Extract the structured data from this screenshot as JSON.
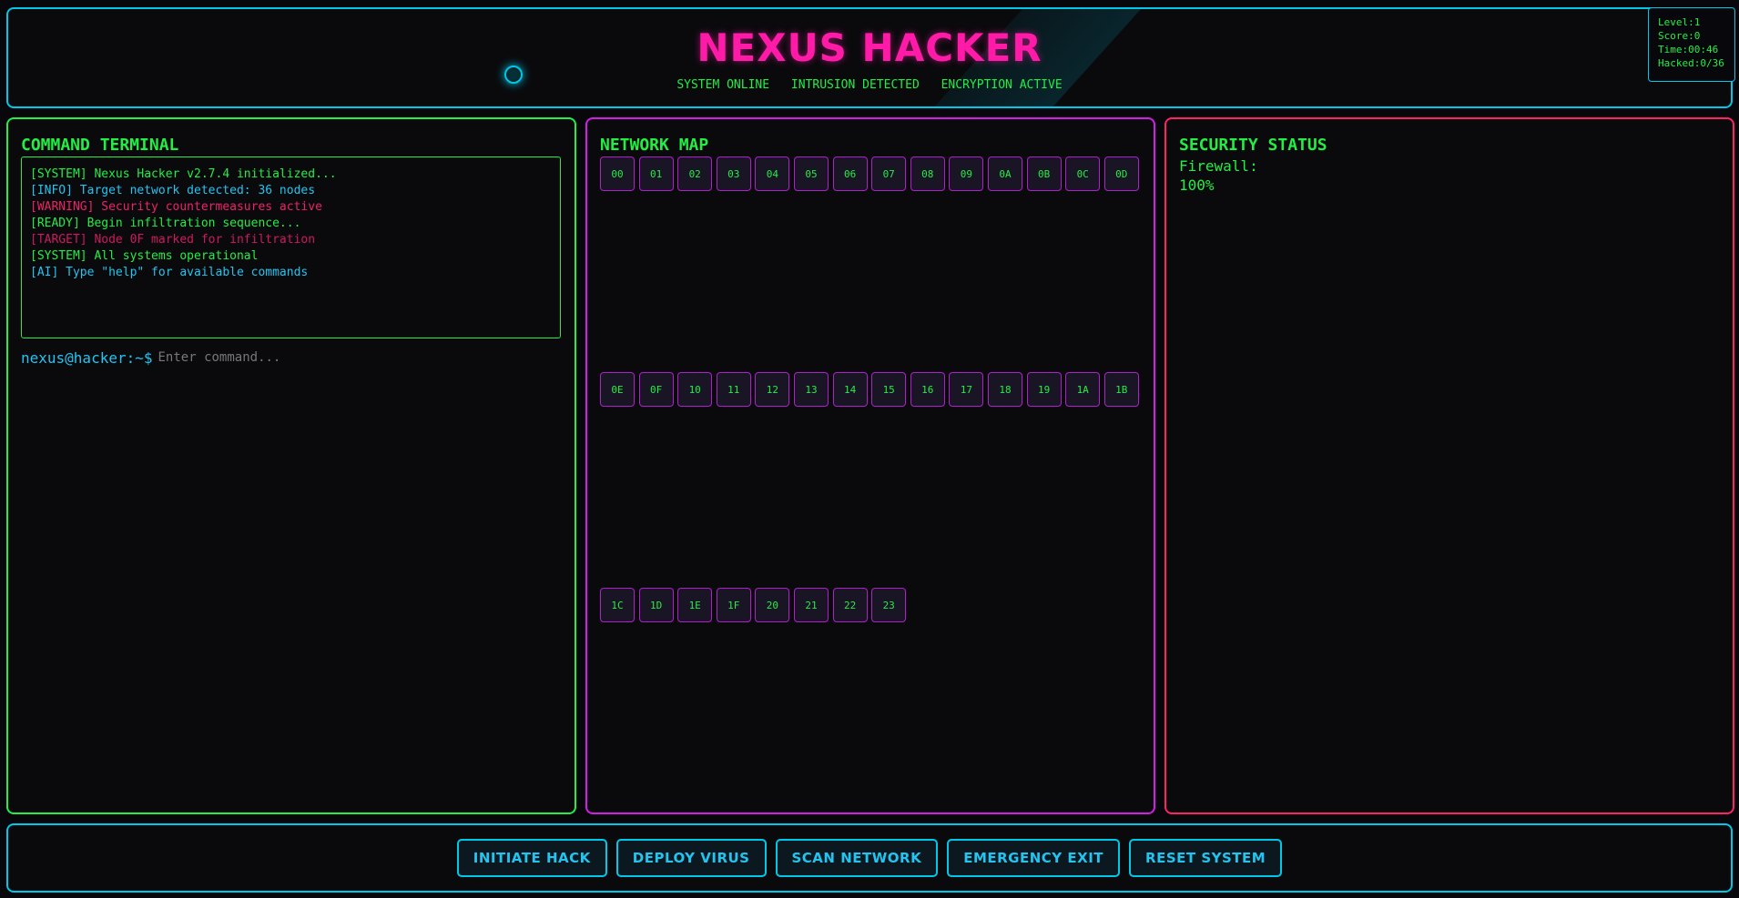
{
  "header": {
    "title": "NEXUS HACKER",
    "status": [
      "SYSTEM ONLINE",
      "INTRUSION DETECTED",
      "ENCRYPTION ACTIVE"
    ]
  },
  "hud": {
    "level": "Level:1",
    "score": "Score:0",
    "time": "Time:00:46",
    "hacked": "Hacked:0/36"
  },
  "terminal": {
    "title": "COMMAND TERMINAL",
    "log": [
      {
        "text": "[SYSTEM] Nexus Hacker v2.7.4 initialized...",
        "color": "#22ee44"
      },
      {
        "text": "[INFO] Target network detected: 36 nodes",
        "color": "#22c4f0"
      },
      {
        "text": "[WARNING] Security countermeasures active",
        "color": "#ee2266"
      },
      {
        "text": "[READY] Begin infiltration sequence...",
        "color": "#22ee44"
      },
      {
        "text": "[TARGET] Node 0F marked for infiltration",
        "color": "#d01860"
      },
      {
        "text": "[SYSTEM] All systems operational",
        "color": "#22ee44"
      },
      {
        "text": "[AI] Type \"help\" for available commands",
        "color": "#22c4f0"
      }
    ],
    "prompt": "nexus@hacker:~$",
    "input_placeholder": "Enter command...",
    "input_value": ""
  },
  "network": {
    "title": "NETWORK MAP",
    "nodes": [
      "00",
      "01",
      "02",
      "03",
      "04",
      "05",
      "06",
      "07",
      "08",
      "09",
      "0A",
      "0B",
      "0C",
      "0D",
      "0E",
      "0F",
      "10",
      "11",
      "12",
      "13",
      "14",
      "15",
      "16",
      "17",
      "18",
      "19",
      "1A",
      "1B",
      "1C",
      "1D",
      "1E",
      "1F",
      "20",
      "21",
      "22",
      "23"
    ]
  },
  "security": {
    "title": "SECURITY STATUS",
    "firewall_label": "Firewall:",
    "firewall_value": "100%"
  },
  "controls": {
    "initiate": "INITIATE HACK",
    "deploy": "DEPLOY VIRUS",
    "scan": "SCAN NETWORK",
    "emergency": "EMERGENCY EXIT",
    "reset": "RESET SYSTEM"
  },
  "colors": {
    "accent_cyan": "#00c8e8",
    "accent_green": "#22ee44",
    "accent_magenta": "#d21ee6",
    "accent_red": "#ff2266",
    "title_pink": "#ff1aa8"
  }
}
